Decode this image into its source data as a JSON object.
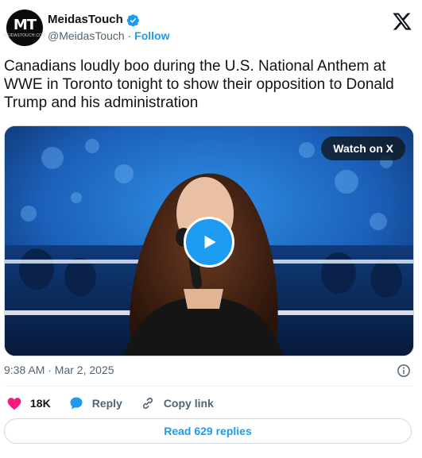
{
  "author": {
    "display_name": "MeidasTouch",
    "handle": "@MeidasTouch",
    "separator": "·",
    "follow_label": "Follow",
    "avatar_text": "MT",
    "avatar_subtext": "MEIDASTOUCH.COM"
  },
  "tweet": {
    "text": "Canadians loudly boo during the U.S. National Anthem at WWE in Toronto tonight to show their opposition to Donald Trump and his administration"
  },
  "media": {
    "watch_label": "Watch on X"
  },
  "meta": {
    "timestamp": "9:38 AM · Mar 2, 2025"
  },
  "actions": {
    "likes": "18K",
    "reply_label": "Reply",
    "copy_link_label": "Copy link"
  },
  "replies_button": "Read 629 replies",
  "colors": {
    "accent": "#1d9bf0",
    "like": "#f91880",
    "text": "#0f1419",
    "muted": "#536471"
  },
  "icons": [
    "verified-badge-icon",
    "x-logo-icon",
    "play-icon",
    "info-icon",
    "heart-icon",
    "reply-bubble-icon",
    "link-icon"
  ]
}
